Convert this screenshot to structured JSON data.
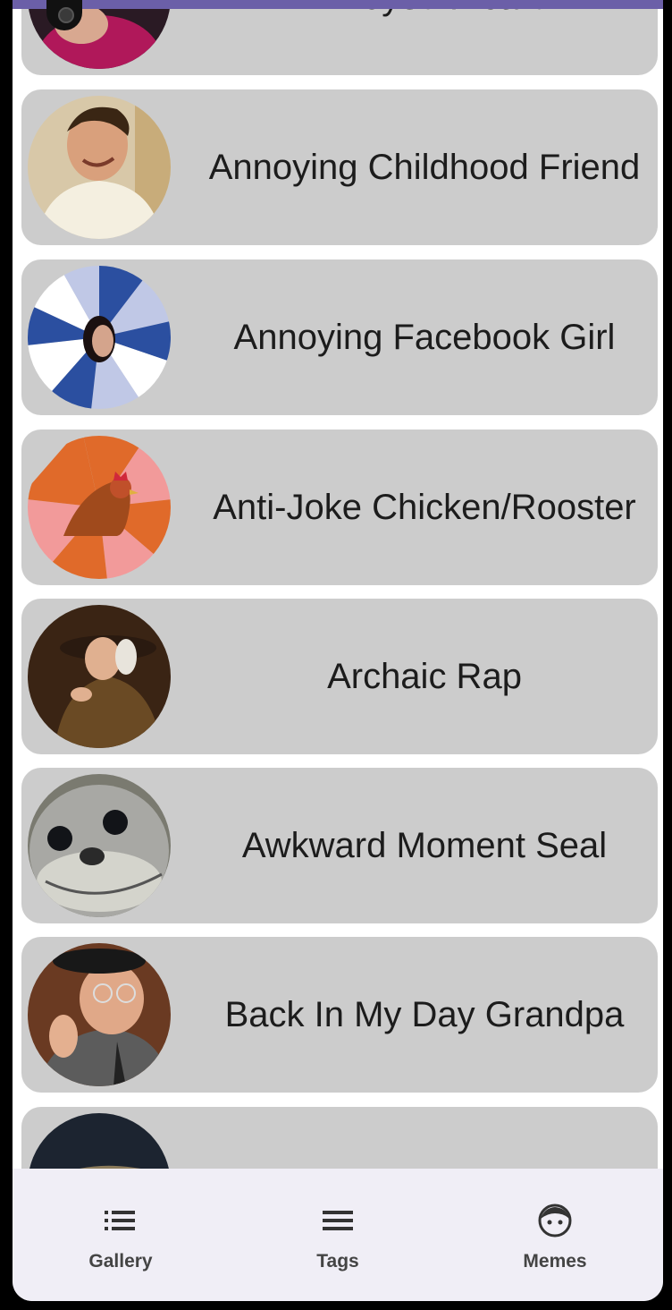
{
  "colors": {
    "accent": "#6b5fa8",
    "card": "#cccccc",
    "nav_bg": "#f0eef6"
  },
  "memes": [
    {
      "name": "Annoyed Picard",
      "image": "picard-avatar"
    },
    {
      "name": "Annoying Childhood Friend",
      "image": "childhood-friend-avatar"
    },
    {
      "name": "Annoying Facebook Girl",
      "image": "facebook-girl-avatar"
    },
    {
      "name": "Anti-Joke Chicken/Rooster",
      "image": "chicken-avatar"
    },
    {
      "name": "Archaic Rap",
      "image": "archaic-rap-avatar"
    },
    {
      "name": "Awkward Moment Seal",
      "image": "seal-avatar"
    },
    {
      "name": "Back In My Day Grandpa",
      "image": "grandpa-avatar"
    },
    {
      "name": "",
      "image": "next-avatar"
    }
  ],
  "nav": [
    {
      "label": "Gallery",
      "icon": "list-icon"
    },
    {
      "label": "Tags",
      "icon": "menu-icon"
    },
    {
      "label": "Memes",
      "icon": "face-icon"
    }
  ]
}
